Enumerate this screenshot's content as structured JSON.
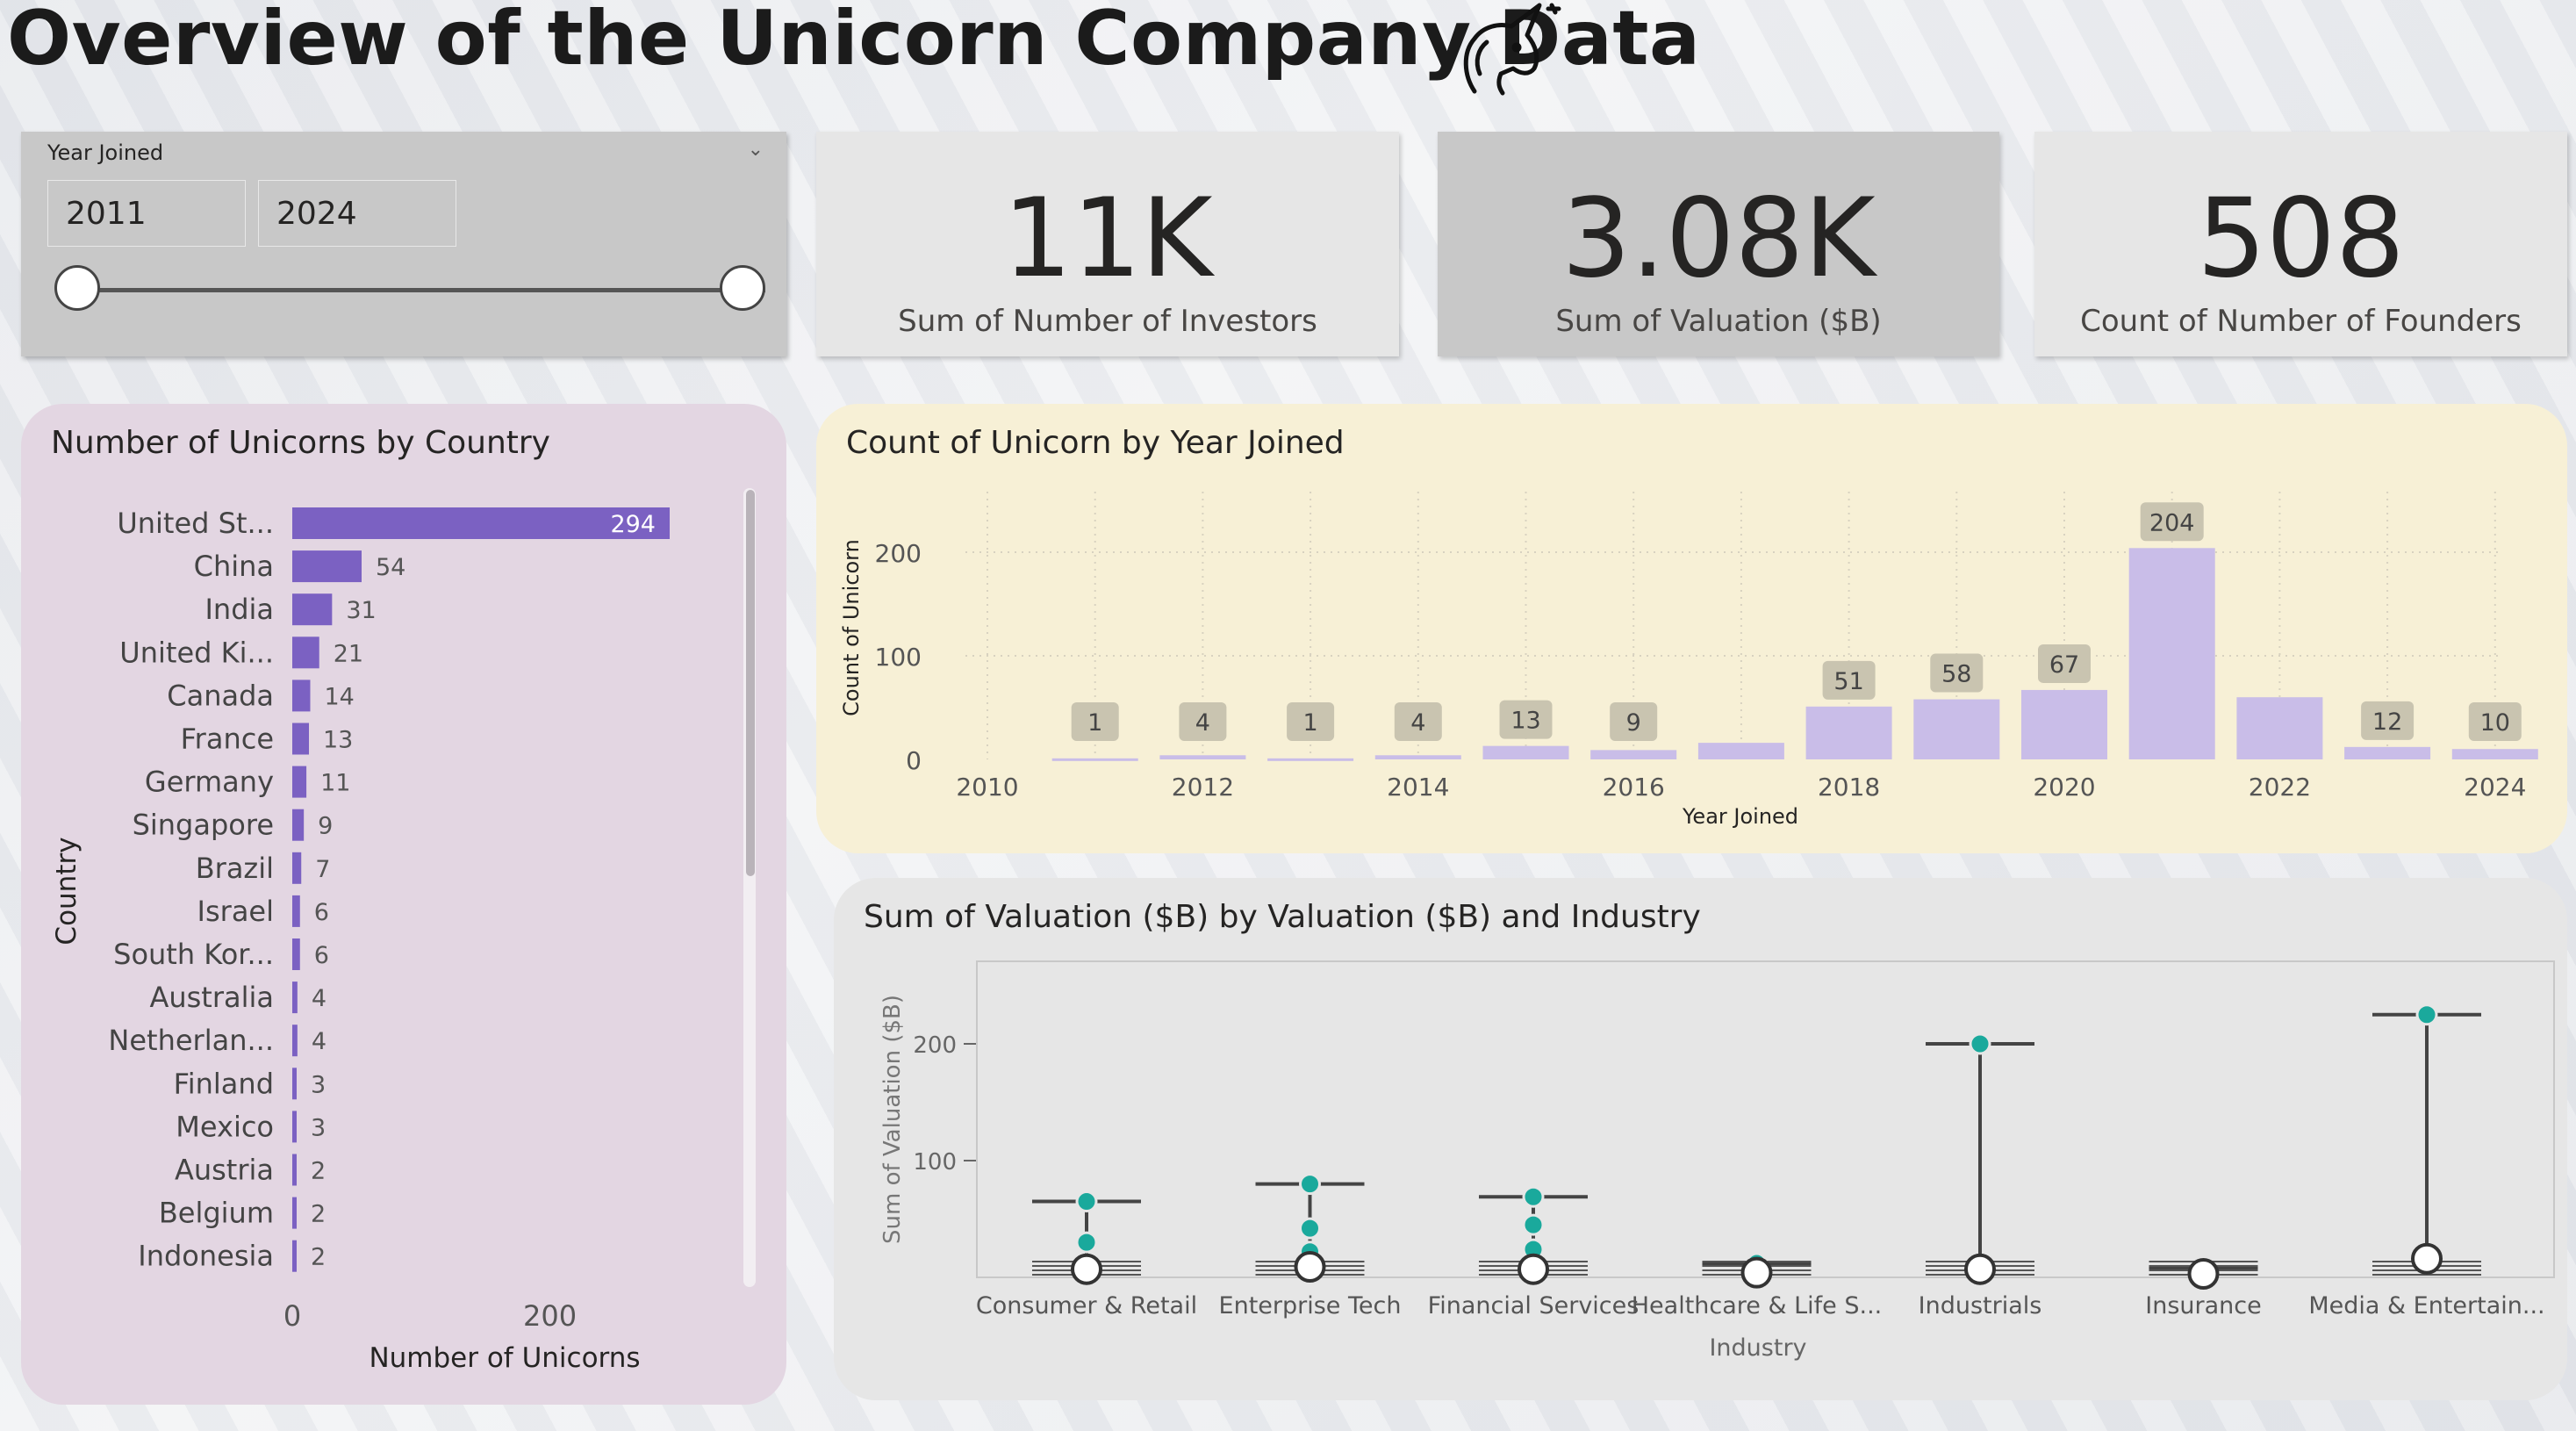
{
  "title": "Overview of the Unicorn Company Data",
  "slicer": {
    "label": "Year Joined",
    "start": "2011",
    "end": "2024"
  },
  "kpis": [
    {
      "value": "11K",
      "label": "Sum of Number of Investors"
    },
    {
      "value": "3.08K",
      "label": "Sum of Valuation ($B)"
    },
    {
      "value": "508",
      "label": "Count of Number of Founders"
    }
  ],
  "colors": {
    "country_bar": "#7b61c2",
    "year_bar": "#c9bde8",
    "dot": "#1aa99c",
    "country_bg": "#e3d6e2",
    "year_bg": "#f7f0d6"
  },
  "chart_data": [
    {
      "type": "bar",
      "orientation": "horizontal",
      "title": "Number of Unicorns by Country",
      "xlabel": "Number of Unicorns",
      "ylabel": "Country",
      "categories": [
        "United St...",
        "China",
        "India",
        "United Ki...",
        "Canada",
        "France",
        "Germany",
        "Singapore",
        "Brazil",
        "Israel",
        "South Kor...",
        "Australia",
        "Netherlan...",
        "Finland",
        "Mexico",
        "Austria",
        "Belgium",
        "Indonesia"
      ],
      "values": [
        294,
        54,
        31,
        21,
        14,
        13,
        11,
        9,
        7,
        6,
        6,
        4,
        4,
        3,
        3,
        2,
        2,
        2
      ],
      "xticks": [
        "0",
        "200"
      ],
      "xlim": [
        0,
        294
      ]
    },
    {
      "type": "bar",
      "title": "Count of Unicorn by Year Joined",
      "xlabel": "Year Joined",
      "ylabel": "Count of Unicorn",
      "x": [
        2011,
        2012,
        2013,
        2014,
        2015,
        2016,
        2017,
        2018,
        2019,
        2020,
        2021,
        2022,
        2023,
        2024
      ],
      "values": [
        1,
        4,
        1,
        4,
        13,
        9,
        16,
        51,
        58,
        67,
        204,
        60,
        12,
        10
      ],
      "labels": [
        "1",
        "4",
        "1",
        "4",
        "13",
        "9",
        "",
        "51",
        "58",
        "67",
        "204",
        "",
        "12",
        "10"
      ],
      "xticks": [
        "2010",
        "2012",
        "2014",
        "2016",
        "2018",
        "2020",
        "2022",
        "2024"
      ],
      "yticks": [
        "0",
        "100",
        "200"
      ],
      "xlim": [
        2010,
        2024
      ],
      "ylim": [
        0,
        215
      ]
    },
    {
      "type": "scatter",
      "title": "Sum of Valuation ($B) by Valuation ($B) and Industry",
      "xlabel": "Industry",
      "ylabel": "Sum of Valuation ($B)",
      "categories": [
        "Consumer & Retail",
        "Enterprise Tech",
        "Financial Services",
        "Healthcare & Life S...",
        "Industrials",
        "Insurance",
        "Media & Entertain..."
      ],
      "max": [
        65,
        80,
        69,
        12,
        200,
        8,
        225
      ],
      "min": [
        1,
        1,
        1,
        1,
        1,
        1,
        1
      ],
      "median": [
        7,
        9,
        7,
        4,
        7,
        3,
        16
      ],
      "dots": [
        [
          65,
          30
        ],
        [
          80,
          42,
          22
        ],
        [
          69,
          45,
          24
        ],
        [
          12
        ],
        [
          200
        ],
        [],
        [
          225
        ]
      ],
      "yticks": [
        "100",
        "200"
      ],
      "ylim": [
        0,
        250
      ]
    }
  ]
}
